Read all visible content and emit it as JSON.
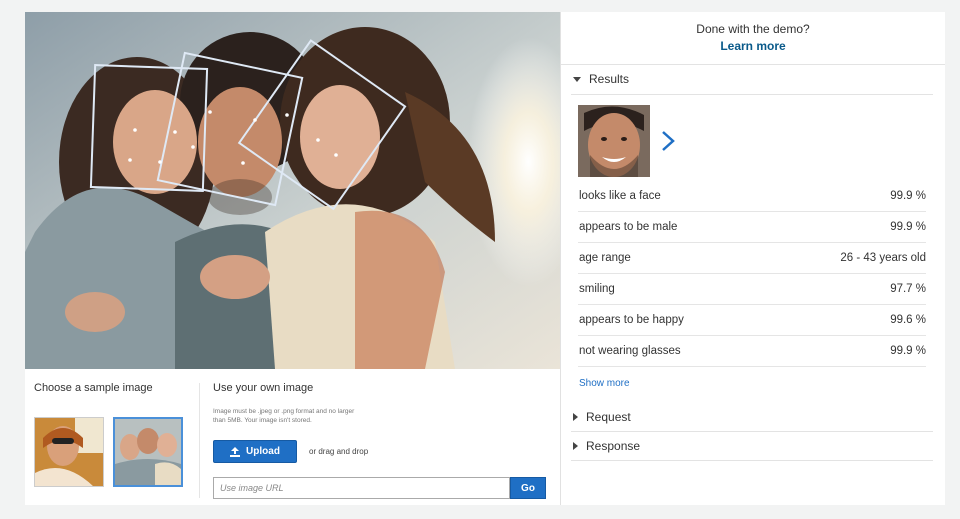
{
  "left": {
    "sample_title": "Choose a sample image",
    "own_title": "Use your own image",
    "own_note": "Image must be .jpeg or .png format and no larger than 5MB. Your image isn't stored.",
    "upload_label": "Upload",
    "drag_text": "or drag and drop",
    "url_placeholder": "Use image URL",
    "go_label": "Go"
  },
  "right": {
    "done_text": "Done with the demo?",
    "learn_more": "Learn more",
    "results_label": "Results",
    "rows": [
      {
        "label": "looks like a face",
        "value": "99.9 %"
      },
      {
        "label": "appears to be male",
        "value": "99.9 %"
      },
      {
        "label": "age range",
        "value": "26 - 43 years old"
      },
      {
        "label": "smiling",
        "value": "97.7 %"
      },
      {
        "label": "appears to be happy",
        "value": "99.6 %"
      },
      {
        "label": "not wearing glasses",
        "value": "99.9 %"
      }
    ],
    "show_more": "Show more",
    "request_label": "Request",
    "response_label": "Response"
  },
  "icons": {
    "upload": "upload-icon",
    "results_caret": "caret-down-icon",
    "section_caret": "caret-right-icon",
    "next": "chevron-right-icon"
  },
  "colors": {
    "accent": "#1f6fc5",
    "link": "#0a5a8a",
    "face_box": "#dfe9f5"
  }
}
